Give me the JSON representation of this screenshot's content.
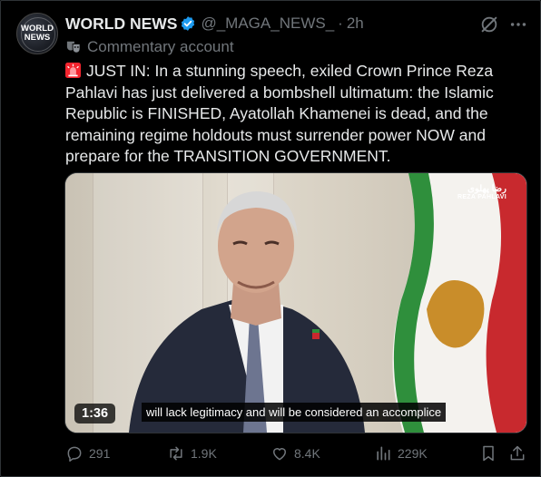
{
  "author": {
    "avatar_text_line1": "WORLD",
    "avatar_text_line2": "NEWS",
    "name": "WORLD NEWS",
    "handle": "@_MAGA_NEWS_",
    "separator": "·",
    "time": "2h",
    "label": "Commentary account",
    "verified_color": "#1d9bf0"
  },
  "tweet": {
    "text": "JUST IN: In a stunning speech, exiled Crown Prince Reza Pahlavi has just delivered a bombshell ultimatum: the Islamic Republic is FINISHED, Ayatollah Khamenei is dead, and the remaining regime holdouts must surrender power NOW and prepare for the TRANSITION GOVERNMENT.",
    "emoji_icon": "police-siren-icon"
  },
  "video": {
    "duration": "1:36",
    "caption": "will lack legitimacy and will be considered an accomplice",
    "brand_fa": "رضا پهلوی",
    "brand_en": "REZA PAHLAVI"
  },
  "actions": {
    "replies": "291",
    "reposts": "1.9K",
    "likes": "8.4K",
    "views": "229K"
  }
}
